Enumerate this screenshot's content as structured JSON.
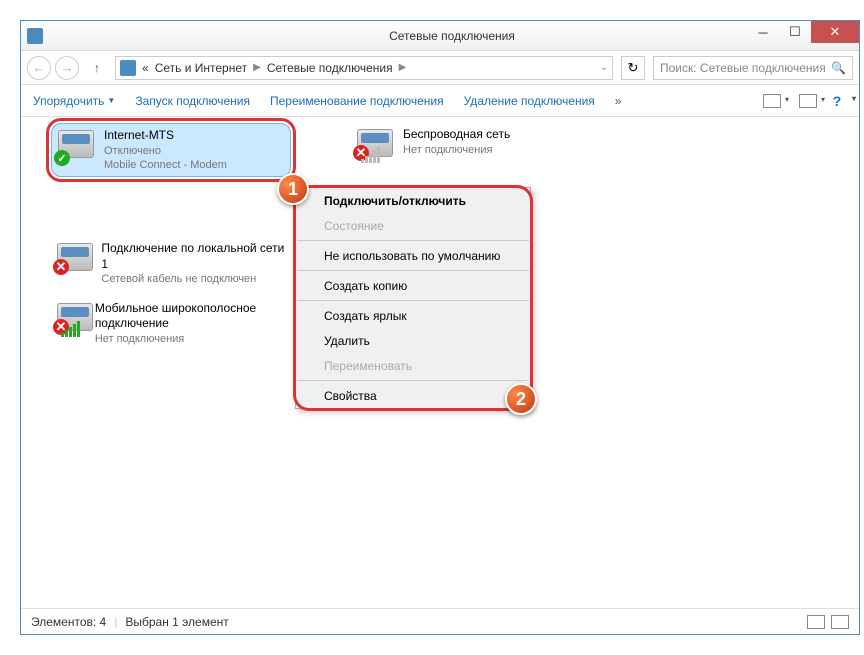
{
  "window": {
    "title": "Сетевые подключения"
  },
  "breadcrumb": {
    "prefix": "«",
    "level1": "Сеть и Интернет",
    "level2": "Сетевые подключения"
  },
  "search": {
    "placeholder": "Поиск: Сетевые подключения"
  },
  "toolbar": {
    "organize": "Упорядочить",
    "start": "Запуск подключения",
    "rename": "Переименование подключения",
    "delete": "Удаление подключения",
    "more": "»"
  },
  "connections": [
    {
      "name": "Internet-MTS",
      "status": "Отключено",
      "detail": "Mobile Connect - Modem"
    },
    {
      "name": "Беспроводная сеть",
      "status": "Нет подключения",
      "detail": ""
    },
    {
      "name": "Подключение по локальной сети 1",
      "status": "Сетевой кабель не подключен",
      "detail": ""
    },
    {
      "name": "Мобильное широкополосное подключение",
      "status": "Нет подключения",
      "detail": ""
    }
  ],
  "contextmenu": {
    "connect": "Подключить/отключить",
    "status": "Состояние",
    "nodefault": "Не использовать по умолчанию",
    "copy": "Создать копию",
    "shortcut": "Создать ярлык",
    "delete": "Удалить",
    "rename": "Переименовать",
    "properties": "Свойства"
  },
  "statusbar": {
    "count": "Элементов: 4",
    "selected": "Выбран 1 элемент"
  },
  "badges": {
    "b1": "1",
    "b2": "2"
  }
}
